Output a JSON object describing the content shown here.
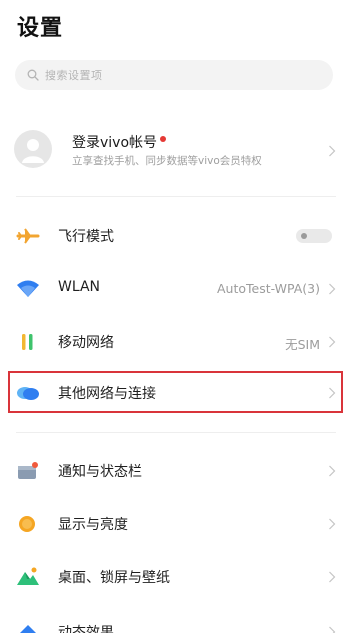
{
  "header": {
    "title": "设置"
  },
  "search": {
    "placeholder": "搜索设置项"
  },
  "account": {
    "title": "登录vivo帐号",
    "subtitle": "立享查找手机、同步数据等vivo会员特权"
  },
  "settings": {
    "airplane": {
      "label": "飞行模式",
      "toggle_on": false
    },
    "wlan": {
      "label": "WLAN",
      "value": "AutoTest-WPA(3)"
    },
    "mobile": {
      "label": "移动网络",
      "value": "无SIM"
    },
    "other_network": {
      "label": "其他网络与连接"
    },
    "notifications": {
      "label": "通知与状态栏"
    },
    "display": {
      "label": "显示与亮度"
    },
    "desktop": {
      "label": "桌面、锁屏与壁纸"
    },
    "dynamic": {
      "label": "动态效果"
    }
  },
  "colors": {
    "accent_highlight": "#d9343a",
    "airplane_icon": "#f2a531",
    "wlan_icon": "#2f7ef0",
    "mobile_icon_green": "#3ec36c",
    "mobile_icon_yellow": "#f2b731",
    "other_network_icon": "#2f9bf0",
    "display_icon": "#f5a623",
    "desktop_icon": "#2ec07a"
  }
}
